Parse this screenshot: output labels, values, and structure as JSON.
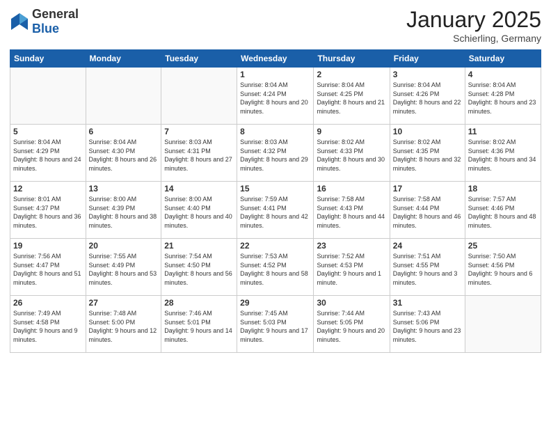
{
  "header": {
    "logo_general": "General",
    "logo_blue": "Blue",
    "month_year": "January 2025",
    "location": "Schierling, Germany"
  },
  "weekdays": [
    "Sunday",
    "Monday",
    "Tuesday",
    "Wednesday",
    "Thursday",
    "Friday",
    "Saturday"
  ],
  "weeks": [
    [
      {
        "day": "",
        "sunrise": "",
        "sunset": "",
        "daylight": ""
      },
      {
        "day": "",
        "sunrise": "",
        "sunset": "",
        "daylight": ""
      },
      {
        "day": "",
        "sunrise": "",
        "sunset": "",
        "daylight": ""
      },
      {
        "day": "1",
        "sunrise": "Sunrise: 8:04 AM",
        "sunset": "Sunset: 4:24 PM",
        "daylight": "Daylight: 8 hours and 20 minutes."
      },
      {
        "day": "2",
        "sunrise": "Sunrise: 8:04 AM",
        "sunset": "Sunset: 4:25 PM",
        "daylight": "Daylight: 8 hours and 21 minutes."
      },
      {
        "day": "3",
        "sunrise": "Sunrise: 8:04 AM",
        "sunset": "Sunset: 4:26 PM",
        "daylight": "Daylight: 8 hours and 22 minutes."
      },
      {
        "day": "4",
        "sunrise": "Sunrise: 8:04 AM",
        "sunset": "Sunset: 4:28 PM",
        "daylight": "Daylight: 8 hours and 23 minutes."
      }
    ],
    [
      {
        "day": "5",
        "sunrise": "Sunrise: 8:04 AM",
        "sunset": "Sunset: 4:29 PM",
        "daylight": "Daylight: 8 hours and 24 minutes."
      },
      {
        "day": "6",
        "sunrise": "Sunrise: 8:04 AM",
        "sunset": "Sunset: 4:30 PM",
        "daylight": "Daylight: 8 hours and 26 minutes."
      },
      {
        "day": "7",
        "sunrise": "Sunrise: 8:03 AM",
        "sunset": "Sunset: 4:31 PM",
        "daylight": "Daylight: 8 hours and 27 minutes."
      },
      {
        "day": "8",
        "sunrise": "Sunrise: 8:03 AM",
        "sunset": "Sunset: 4:32 PM",
        "daylight": "Daylight: 8 hours and 29 minutes."
      },
      {
        "day": "9",
        "sunrise": "Sunrise: 8:02 AM",
        "sunset": "Sunset: 4:33 PM",
        "daylight": "Daylight: 8 hours and 30 minutes."
      },
      {
        "day": "10",
        "sunrise": "Sunrise: 8:02 AM",
        "sunset": "Sunset: 4:35 PM",
        "daylight": "Daylight: 8 hours and 32 minutes."
      },
      {
        "day": "11",
        "sunrise": "Sunrise: 8:02 AM",
        "sunset": "Sunset: 4:36 PM",
        "daylight": "Daylight: 8 hours and 34 minutes."
      }
    ],
    [
      {
        "day": "12",
        "sunrise": "Sunrise: 8:01 AM",
        "sunset": "Sunset: 4:37 PM",
        "daylight": "Daylight: 8 hours and 36 minutes."
      },
      {
        "day": "13",
        "sunrise": "Sunrise: 8:00 AM",
        "sunset": "Sunset: 4:39 PM",
        "daylight": "Daylight: 8 hours and 38 minutes."
      },
      {
        "day": "14",
        "sunrise": "Sunrise: 8:00 AM",
        "sunset": "Sunset: 4:40 PM",
        "daylight": "Daylight: 8 hours and 40 minutes."
      },
      {
        "day": "15",
        "sunrise": "Sunrise: 7:59 AM",
        "sunset": "Sunset: 4:41 PM",
        "daylight": "Daylight: 8 hours and 42 minutes."
      },
      {
        "day": "16",
        "sunrise": "Sunrise: 7:58 AM",
        "sunset": "Sunset: 4:43 PM",
        "daylight": "Daylight: 8 hours and 44 minutes."
      },
      {
        "day": "17",
        "sunrise": "Sunrise: 7:58 AM",
        "sunset": "Sunset: 4:44 PM",
        "daylight": "Daylight: 8 hours and 46 minutes."
      },
      {
        "day": "18",
        "sunrise": "Sunrise: 7:57 AM",
        "sunset": "Sunset: 4:46 PM",
        "daylight": "Daylight: 8 hours and 48 minutes."
      }
    ],
    [
      {
        "day": "19",
        "sunrise": "Sunrise: 7:56 AM",
        "sunset": "Sunset: 4:47 PM",
        "daylight": "Daylight: 8 hours and 51 minutes."
      },
      {
        "day": "20",
        "sunrise": "Sunrise: 7:55 AM",
        "sunset": "Sunset: 4:49 PM",
        "daylight": "Daylight: 8 hours and 53 minutes."
      },
      {
        "day": "21",
        "sunrise": "Sunrise: 7:54 AM",
        "sunset": "Sunset: 4:50 PM",
        "daylight": "Daylight: 8 hours and 56 minutes."
      },
      {
        "day": "22",
        "sunrise": "Sunrise: 7:53 AM",
        "sunset": "Sunset: 4:52 PM",
        "daylight": "Daylight: 8 hours and 58 minutes."
      },
      {
        "day": "23",
        "sunrise": "Sunrise: 7:52 AM",
        "sunset": "Sunset: 4:53 PM",
        "daylight": "Daylight: 9 hours and 1 minute."
      },
      {
        "day": "24",
        "sunrise": "Sunrise: 7:51 AM",
        "sunset": "Sunset: 4:55 PM",
        "daylight": "Daylight: 9 hours and 3 minutes."
      },
      {
        "day": "25",
        "sunrise": "Sunrise: 7:50 AM",
        "sunset": "Sunset: 4:56 PM",
        "daylight": "Daylight: 9 hours and 6 minutes."
      }
    ],
    [
      {
        "day": "26",
        "sunrise": "Sunrise: 7:49 AM",
        "sunset": "Sunset: 4:58 PM",
        "daylight": "Daylight: 9 hours and 9 minutes."
      },
      {
        "day": "27",
        "sunrise": "Sunrise: 7:48 AM",
        "sunset": "Sunset: 5:00 PM",
        "daylight": "Daylight: 9 hours and 12 minutes."
      },
      {
        "day": "28",
        "sunrise": "Sunrise: 7:46 AM",
        "sunset": "Sunset: 5:01 PM",
        "daylight": "Daylight: 9 hours and 14 minutes."
      },
      {
        "day": "29",
        "sunrise": "Sunrise: 7:45 AM",
        "sunset": "Sunset: 5:03 PM",
        "daylight": "Daylight: 9 hours and 17 minutes."
      },
      {
        "day": "30",
        "sunrise": "Sunrise: 7:44 AM",
        "sunset": "Sunset: 5:05 PM",
        "daylight": "Daylight: 9 hours and 20 minutes."
      },
      {
        "day": "31",
        "sunrise": "Sunrise: 7:43 AM",
        "sunset": "Sunset: 5:06 PM",
        "daylight": "Daylight: 9 hours and 23 minutes."
      },
      {
        "day": "",
        "sunrise": "",
        "sunset": "",
        "daylight": ""
      }
    ]
  ]
}
